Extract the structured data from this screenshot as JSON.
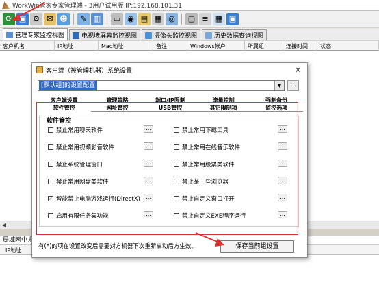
{
  "window": {
    "title": "WorkWin管家专家管理端 - 3用户试用版 IP:192.168.101.31"
  },
  "toolbar": {
    "icons": [
      "refresh-icon",
      "monitor-icon",
      "settings-icon",
      "mail-icon",
      "users-icon",
      "tools-icon",
      "chart-icon",
      "screen-icon",
      "camera-icon",
      "folder-icon",
      "clipboard-icon",
      "disk-icon",
      "display-icon",
      "list-icon",
      "grid-icon",
      "window-icon"
    ]
  },
  "view_tabs": [
    {
      "label": "管理专家监控视图"
    },
    {
      "label": "电视墙屏幕监控视图"
    },
    {
      "label": "摄像头监控视图"
    },
    {
      "label": "历史数据查询视图"
    }
  ],
  "grid": {
    "columns": [
      "客户机名",
      "IP地址",
      "Mac地址",
      "备注",
      "Windows帐户",
      "所属组",
      "连接时间",
      "状态"
    ]
  },
  "bottom": {
    "title": "局域网中尤",
    "columns": [
      "IP地址"
    ]
  },
  "dialog": {
    "title": "客户端（被管理机器）系统设置",
    "close": "×",
    "combo_value": "[默认组]的设置配置",
    "combo_button": "...",
    "tabs_upper": [
      "客户端设置",
      "管理策略",
      "端口/IP限制",
      "流量控制",
      "强制备份"
    ],
    "tabs_lower": [
      "软件管控",
      "网址管控",
      "USB管控",
      "其它限制项",
      "监控选项"
    ],
    "group_label": "软件管控",
    "options_left": [
      {
        "label": "禁止常用聊天软件",
        "checked": false
      },
      {
        "label": "禁止常用视频影音软件",
        "checked": false
      },
      {
        "label": "禁止系统管理窗口",
        "checked": false
      },
      {
        "label": "禁止常用网盘类软件",
        "checked": false
      },
      {
        "label": "智能禁止电脑游戏运行(DirectX)",
        "checked": true
      },
      {
        "label": "启用有限任务集功能",
        "checked": false
      }
    ],
    "options_right": [
      {
        "label": "禁止常用下载工具",
        "checked": false
      },
      {
        "label": "禁止常用在线音乐软件",
        "checked": false
      },
      {
        "label": "禁止常用股票类软件",
        "checked": false
      },
      {
        "label": "禁止某一些浏览器",
        "checked": false
      },
      {
        "label": "禁止自定义窗口打开",
        "checked": false
      },
      {
        "label": "禁止自定义EXE程序运行",
        "checked": false
      }
    ],
    "ellipsis": "...",
    "hint": "有(*)的项在设置改变后需要对方机器下次重新启动后方生效。",
    "save_label": "保存当前组设置"
  },
  "colors": {
    "highlight": "#316ac5",
    "annotation": "#e0302e"
  }
}
